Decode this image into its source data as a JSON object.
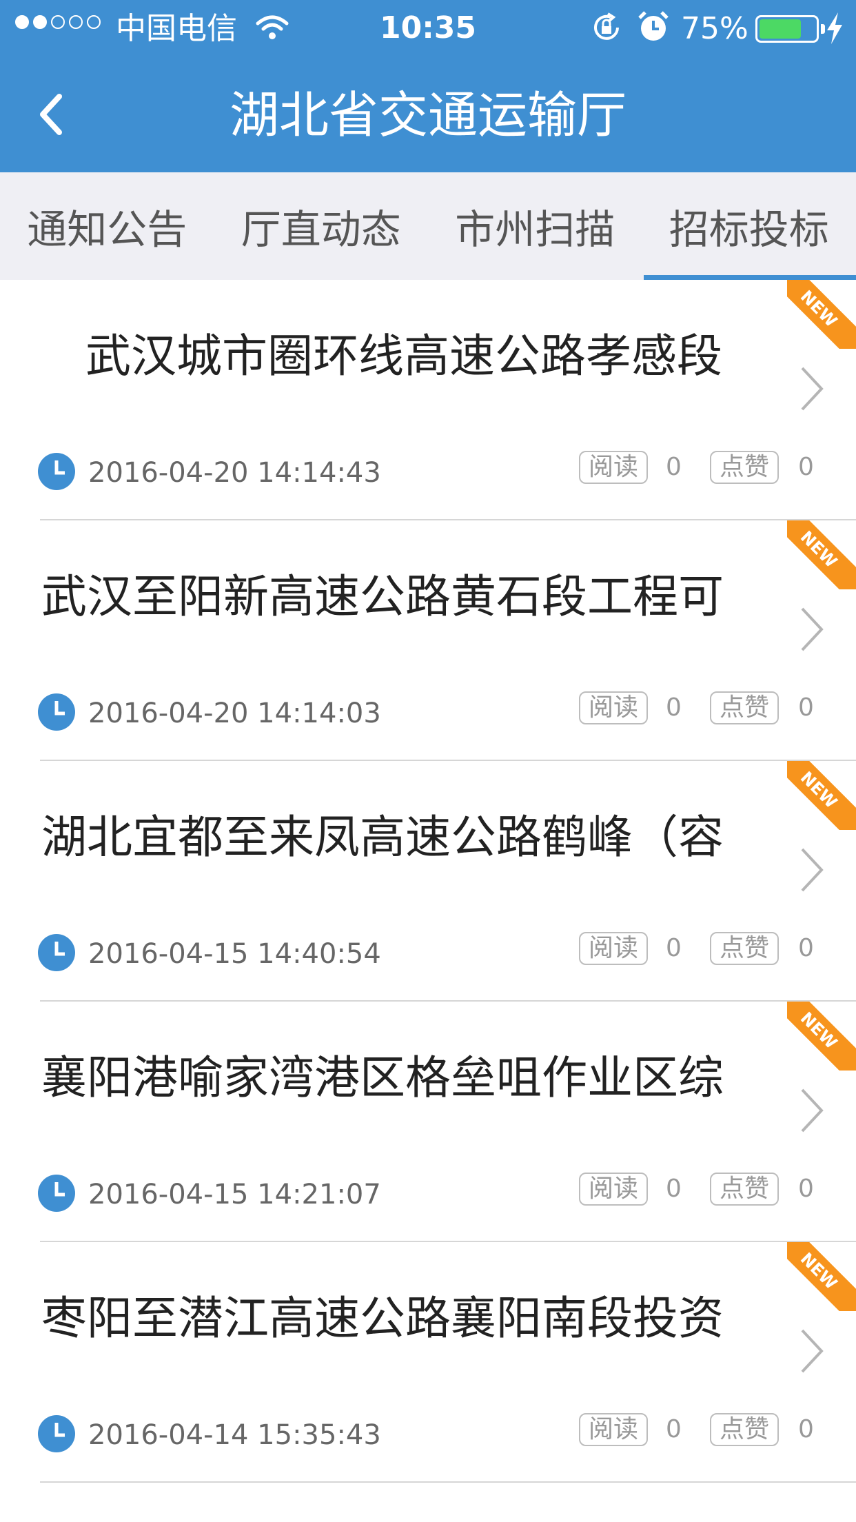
{
  "status_bar": {
    "carrier": "中国电信",
    "time": "10:35",
    "battery_percent": "75%",
    "battery_level": 0.75,
    "signal_dots_filled": 2,
    "signal_dots_total": 5,
    "icons": [
      "wifi-icon",
      "rotation-lock-icon",
      "alarm-icon",
      "battery-icon",
      "charging-bolt-icon"
    ]
  },
  "nav": {
    "title": "湖北省交通运输厅",
    "back_icon": "chevron-left-icon"
  },
  "tabs": [
    {
      "label": "通知公告",
      "active": false
    },
    {
      "label": "厅直动态",
      "active": false
    },
    {
      "label": "市州扫描",
      "active": false
    },
    {
      "label": "招标投标",
      "active": true
    }
  ],
  "list": {
    "new_badge": "NEW",
    "read_label": "阅读",
    "like_label": "点赞",
    "items": [
      {
        "title": "武汉城市圈环线高速公路孝感段",
        "date": "2016-04-20 14:14:43",
        "reads": "0",
        "likes": "0"
      },
      {
        "title": "武汉至阳新高速公路黄石段工程可",
        "date": "2016-04-20 14:14:03",
        "reads": "0",
        "likes": "0"
      },
      {
        "title": "湖北宜都至来凤高速公路鹤峰（容",
        "date": "2016-04-15 14:40:54",
        "reads": "0",
        "likes": "0"
      },
      {
        "title": "襄阳港喻家湾港区格垒咀作业区综",
        "date": "2016-04-15 14:21:07",
        "reads": "0",
        "likes": "0"
      },
      {
        "title": "枣阳至潜江高速公路襄阳南段投资",
        "date": "2016-04-14 15:35:43",
        "reads": "0",
        "likes": "0"
      }
    ]
  },
  "colors": {
    "primary": "#3f8fd2",
    "new_ribbon": "#f7941d",
    "battery_fill": "#4cd964",
    "tab_bar_bg": "#efeff4"
  }
}
